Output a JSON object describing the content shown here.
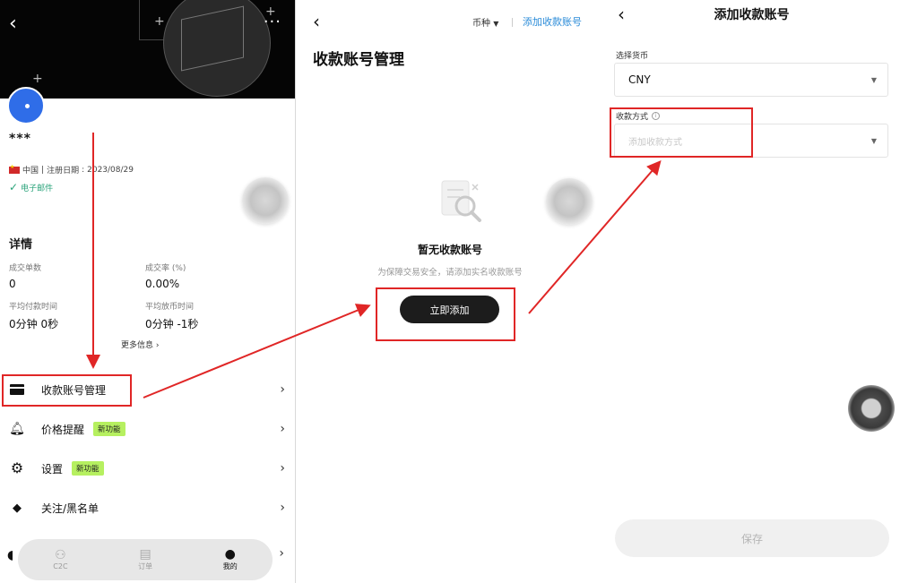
{
  "panel1": {
    "username": "***",
    "country": "中国",
    "register_label": "注册日期",
    "register_date": "2023/08/29",
    "email_verified": "电子邮件",
    "details_title": "详情",
    "stats": [
      {
        "label": "成交单数",
        "value": "0"
      },
      {
        "label": "成交率 (%)",
        "value": "0.00%"
      },
      {
        "label": "平均付款时间",
        "value": "0分钟 0秒"
      },
      {
        "label": "平均放币时间",
        "value": "0分钟 -1秒"
      }
    ],
    "more_info": "更多信息",
    "menu": [
      {
        "label": "收款账号管理",
        "icon": "card-icon",
        "badge": ""
      },
      {
        "label": "价格提醒",
        "icon": "bell-icon",
        "badge": "新功能"
      },
      {
        "label": "设置",
        "icon": "gear-icon",
        "badge": "新功能"
      },
      {
        "label": "关注/黑名单",
        "icon": "tag-icon",
        "badge": ""
      }
    ],
    "bottom_nav": [
      {
        "label": "C2C",
        "icon": "people-icon",
        "active": false
      },
      {
        "label": "订单",
        "icon": "order-icon",
        "active": false
      },
      {
        "label": "我的",
        "icon": "user-icon",
        "active": true
      }
    ]
  },
  "panel2": {
    "currency_label": "币种",
    "add_account_link": "添加收款账号",
    "title": "收款账号管理",
    "empty_title": "暂无收款账号",
    "empty_subtitle": "为保障交易安全，请添加实名收款账号",
    "add_now_button": "立即添加"
  },
  "panel3": {
    "title": "添加收款账号",
    "currency_field_label": "选择货币",
    "currency_value": "CNY",
    "method_field_label": "收款方式",
    "method_placeholder": "添加收款方式",
    "save_button": "保存"
  },
  "colors": {
    "annotation_red": "#e02626",
    "link_blue": "#2a8bd8",
    "badge_green": "#b6f060",
    "verify_green": "#2aa37a"
  }
}
